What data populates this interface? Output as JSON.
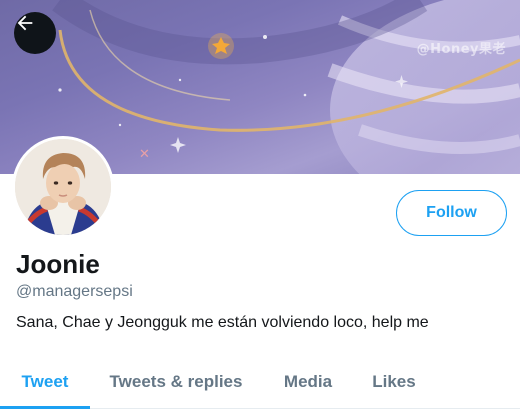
{
  "header": {
    "back_icon": "arrow-left-icon",
    "banner_watermark": "@Honey果老"
  },
  "profile": {
    "display_name": "Joonie",
    "handle": "@managersepsi",
    "bio": "Sana, Chae y Jeongguk me están volviendo loco, help me",
    "follow_label": "Follow"
  },
  "tabs": [
    {
      "label": "Tweet",
      "active": true
    },
    {
      "label": "Tweets & replies",
      "active": false
    },
    {
      "label": "Media",
      "active": false
    },
    {
      "label": "Likes",
      "active": false
    }
  ],
  "colors": {
    "accent": "#1da1f2",
    "text_primary": "#14171a",
    "text_secondary": "#657786"
  }
}
